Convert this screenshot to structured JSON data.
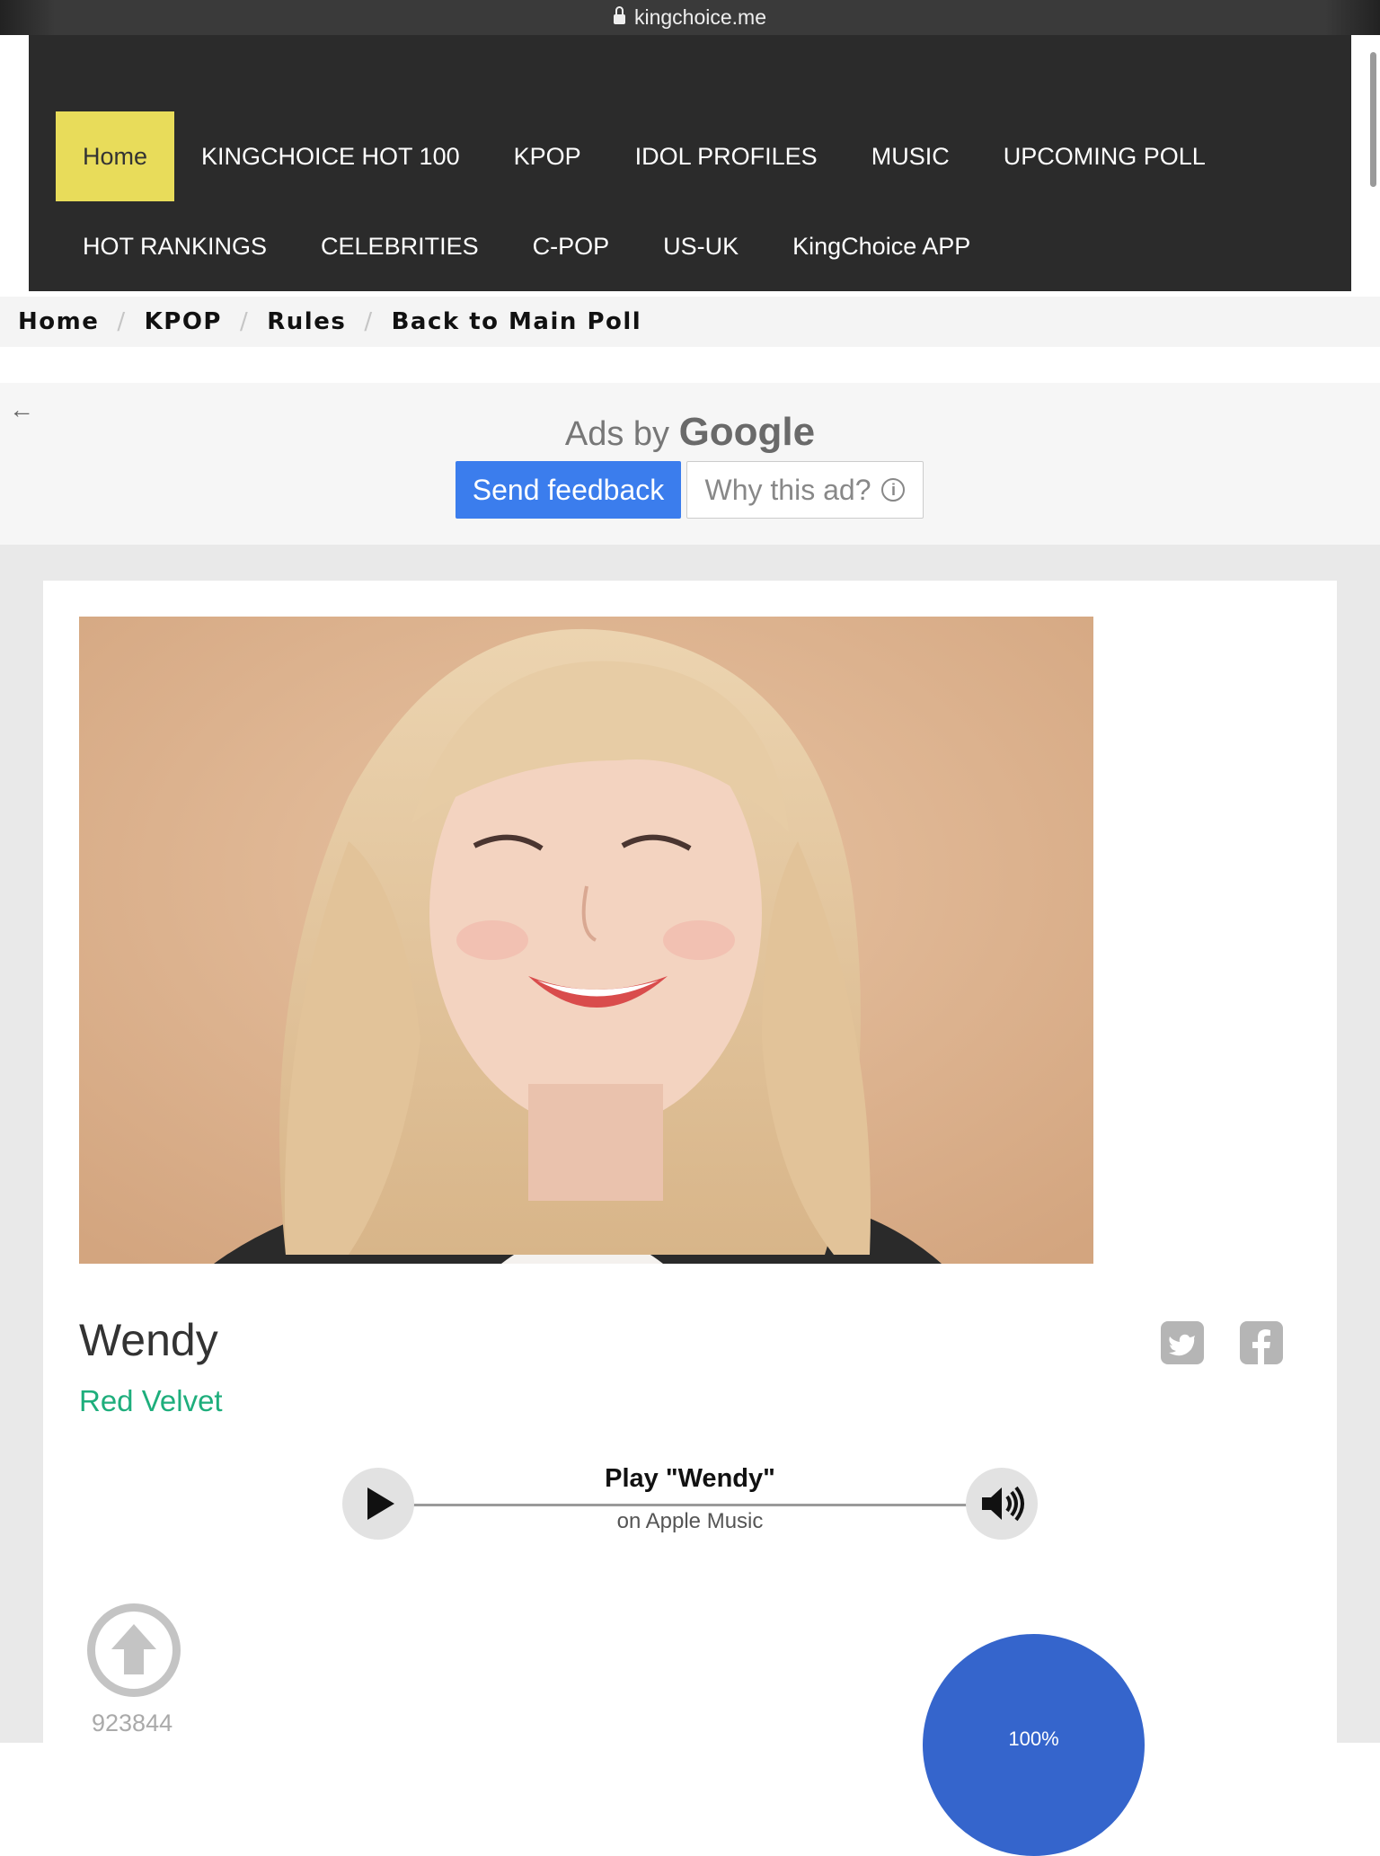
{
  "browser": {
    "url": "kingchoice.me"
  },
  "nav": {
    "row1": [
      "Home",
      "KINGCHOICE HOT 100",
      "KPOP",
      "IDOL PROFILES",
      "MUSIC",
      "UPCOMING POLL"
    ],
    "row2": [
      "HOT RANKINGS",
      "CELEBRITIES",
      "C-POP",
      "US-UK",
      "KingChoice APP"
    ],
    "active": "Home",
    "active_color": "#e8dc5a",
    "background": "#2b2b2b"
  },
  "breadcrumb": [
    "Home",
    "KPOP",
    "Rules",
    "Back to Main Poll"
  ],
  "ad": {
    "ads_by": "Ads by",
    "brand": "Google",
    "send_feedback": "Send feedback",
    "why_this_ad": "Why this ad?",
    "accent": "#3b7ded"
  },
  "profile": {
    "name": "Wendy",
    "group": "Red Velvet",
    "group_color": "#1eae7c"
  },
  "player": {
    "title": "Play \"Wendy\"",
    "subtitle": "on Apple Music"
  },
  "vote": {
    "count": "923844",
    "pie_label": "100%",
    "pie_color": "#3565cc"
  }
}
